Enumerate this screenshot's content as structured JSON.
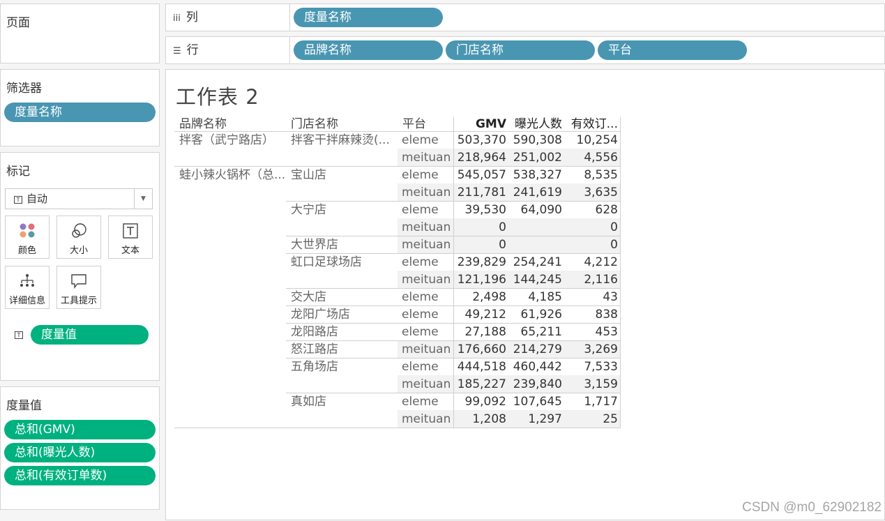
{
  "pages_panel": {
    "title": "页面"
  },
  "columns_shelf": {
    "label": "列",
    "pills": [
      "度量名称"
    ]
  },
  "rows_shelf": {
    "label": "行",
    "pills": [
      "品牌名称",
      "门店名称",
      "平台"
    ]
  },
  "filters_panel": {
    "title": "筛选器",
    "pills": [
      "度量名称"
    ]
  },
  "marks_panel": {
    "title": "标记",
    "mark_type": "自动",
    "buttons": [
      "颜色",
      "大小",
      "文本",
      "详细信息",
      "工具提示"
    ],
    "text_field": "度量值"
  },
  "measure_values_panel": {
    "title": "度量值",
    "pills": [
      "总和(GMV)",
      "总和(曝光人数)",
      "总和(有效订单数)"
    ]
  },
  "sheet": {
    "title": "工作表 2"
  },
  "crosstab": {
    "headers": [
      "品牌名称",
      "门店名称",
      "平台",
      "GMV",
      "曝光人数",
      "有效订..."
    ],
    "rows": [
      [
        "拌客（武宁路店）",
        "拌客干拌麻辣烫(...",
        "eleme",
        "503,370",
        "590,308",
        "10,254"
      ],
      [
        "",
        "",
        "meituan",
        "218,964",
        "251,002",
        "4,556"
      ],
      [
        "蛙小辣火锅杯（总...",
        "宝山店",
        "eleme",
        "545,057",
        "538,327",
        "8,535"
      ],
      [
        "",
        "",
        "meituan",
        "211,781",
        "241,619",
        "3,635"
      ],
      [
        "",
        "大宁店",
        "eleme",
        "39,530",
        "64,090",
        "628"
      ],
      [
        "",
        "",
        "meituan",
        "0",
        "",
        "0"
      ],
      [
        "",
        "大世界店",
        "meituan",
        "0",
        "",
        "0"
      ],
      [
        "",
        "虹口足球场店",
        "eleme",
        "239,829",
        "254,241",
        "4,212"
      ],
      [
        "",
        "",
        "meituan",
        "121,196",
        "144,245",
        "2,116"
      ],
      [
        "",
        "交大店",
        "eleme",
        "2,498",
        "4,185",
        "43"
      ],
      [
        "",
        "龙阳广场店",
        "eleme",
        "49,212",
        "61,926",
        "838"
      ],
      [
        "",
        "龙阳路店",
        "eleme",
        "27,188",
        "65,211",
        "453"
      ],
      [
        "",
        "怒江路店",
        "meituan",
        "176,660",
        "214,279",
        "3,269"
      ],
      [
        "",
        "五角场店",
        "eleme",
        "444,518",
        "460,442",
        "7,533"
      ],
      [
        "",
        "",
        "meituan",
        "185,227",
        "239,840",
        "3,159"
      ],
      [
        "",
        "真如店",
        "eleme",
        "99,092",
        "107,645",
        "1,717"
      ],
      [
        "",
        "",
        "meituan",
        "1,208",
        "1,297",
        "25"
      ]
    ]
  },
  "watermark": "CSDN @m0_62902182"
}
